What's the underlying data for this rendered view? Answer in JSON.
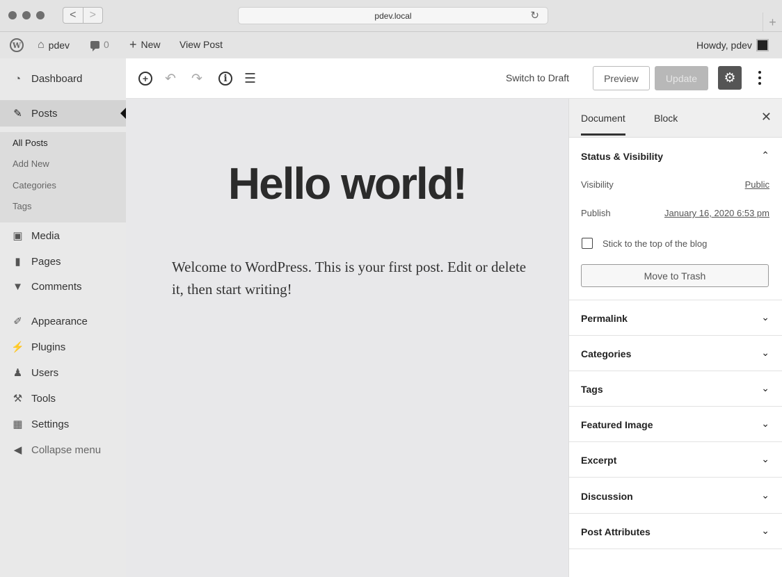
{
  "browser": {
    "url": "pdev.local",
    "back_glyph": "<",
    "forward_glyph": ">",
    "reload_glyph": "↻",
    "newtab_glyph": "+"
  },
  "admin_bar": {
    "site_name": "pdev",
    "comments_count": "0",
    "new_label": "New",
    "view_post_label": "View Post",
    "howdy": "Howdy, pdev"
  },
  "menu": {
    "dashboard": "Dashboard",
    "posts": "Posts",
    "submenu": [
      "All Posts",
      "Add New",
      "Categories",
      "Tags"
    ],
    "media": "Media",
    "pages": "Pages",
    "comments": "Comments",
    "appearance": "Appearance",
    "plugins": "Plugins",
    "users": "Users",
    "tools": "Tools",
    "settings": "Settings",
    "collapse": "Collapse menu"
  },
  "toolbar": {
    "switch_to_draft": "Switch to Draft",
    "preview": "Preview",
    "update": "Update"
  },
  "post": {
    "title": "Hello world!",
    "body": "Welcome to WordPress. This is your first post. Edit or delete it, then start writing!"
  },
  "settings_panel": {
    "tabs": [
      "Document",
      "Block"
    ],
    "status_title": "Status & Visibility",
    "visibility_label": "Visibility",
    "visibility_value": "Public",
    "publish_label": "Publish",
    "publish_value": "January 16, 2020 6:53 pm",
    "sticky_label": "Stick to the top of the blog",
    "trash_label": "Move to Trash",
    "panels": [
      "Permalink",
      "Categories",
      "Tags",
      "Featured Image",
      "Excerpt",
      "Discussion",
      "Post Attributes"
    ]
  },
  "colors": {
    "admin_menu_bg": "#e9e9e9",
    "canvas_bg": "#e8e8ea",
    "settings_button": "#555555",
    "update_disabled": "#b8b8b8"
  }
}
